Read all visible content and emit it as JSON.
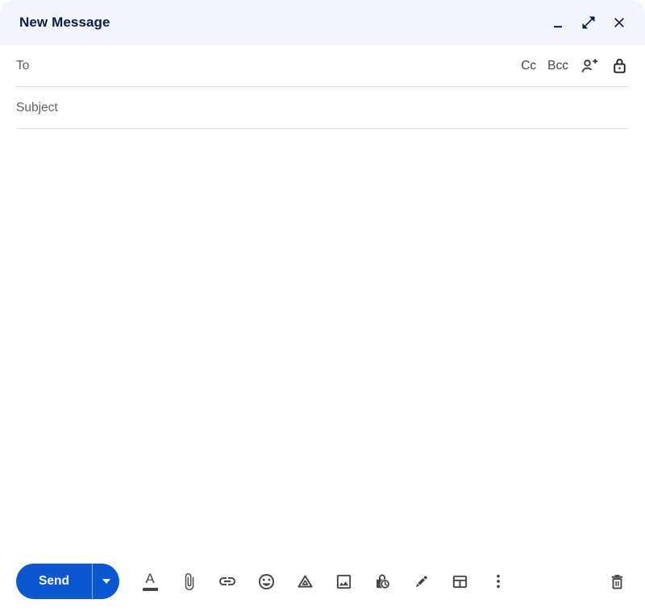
{
  "window": {
    "title": "New Message",
    "controls": {
      "minimize": "minimize",
      "expand": "open-in-full",
      "close": "close"
    }
  },
  "recipients": {
    "to_label": "To",
    "to_value": "",
    "cc_label": "Cc",
    "bcc_label": "Bcc",
    "icons": [
      "add-contacts-icon",
      "lock-icon"
    ]
  },
  "subject": {
    "placeholder": "Subject",
    "value": ""
  },
  "body": {
    "text": ""
  },
  "toolbar": {
    "send_label": "Send",
    "formatting_letter": "A",
    "icons": [
      "formatting-options",
      "attach-file",
      "insert-link",
      "insert-emoji",
      "insert-from-drive",
      "insert-photo",
      "toggle-confidential-mode",
      "insert-signature",
      "insert-table",
      "more-options"
    ],
    "discard_icon": "discard-draft"
  },
  "colors": {
    "send_blue": "#0b57d0",
    "header_bg": "#f2f6fc",
    "header_fg": "#041e49",
    "icon_gray": "#444746",
    "label_gray": "#5f6368",
    "divider": "#e0e0e3"
  }
}
